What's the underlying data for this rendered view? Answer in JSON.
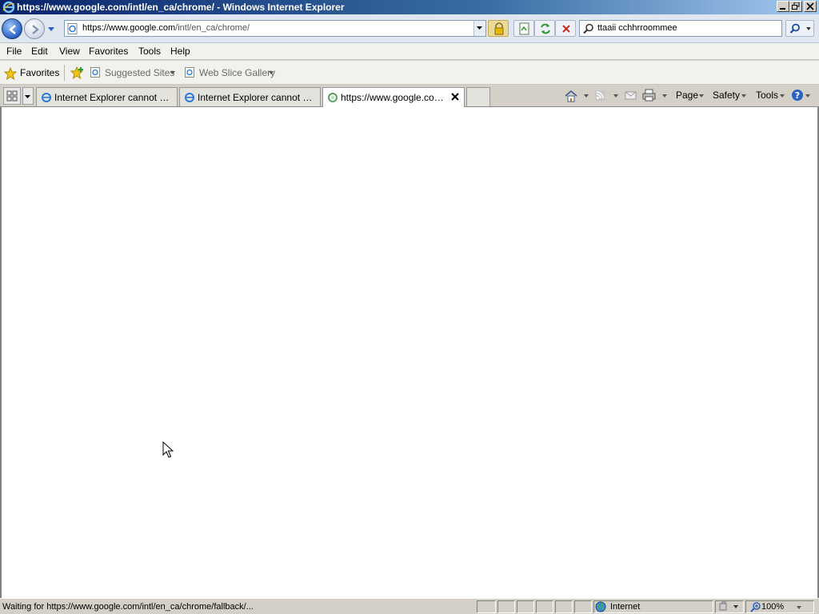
{
  "window": {
    "title": "https://www.google.com/intl/en_ca/chrome/ - Windows Internet Explorer"
  },
  "address_bar": {
    "url_host": "https://www.google.com",
    "url_path": "/intl/en_ca/chrome/"
  },
  "search": {
    "query": "ttaaii  cchhrroommee"
  },
  "menu": {
    "items": [
      "File",
      "Edit",
      "View",
      "Favorites",
      "Tools",
      "Help"
    ]
  },
  "favorites_bar": {
    "favorites_label": "Favorites",
    "links": [
      "Suggested Sites",
      "Web Slice Gallery"
    ]
  },
  "tabs": [
    {
      "label": "Internet Explorer cannot dis...",
      "active": false
    },
    {
      "label": "Internet Explorer cannot dis...",
      "active": false
    },
    {
      "label": "https://www.google.com...",
      "active": true
    }
  ],
  "command_bar": {
    "page_label": "Page",
    "safety_label": "Safety",
    "tools_label": "Tools"
  },
  "status_bar": {
    "text": "Waiting for https://www.google.com/intl/en_ca/chrome/fallback/...",
    "zone": "Internet",
    "zoom": "100%"
  },
  "colors": {
    "title_gradient_start": "#0a246a",
    "title_gradient_end": "#a6caf0",
    "chrome_bg": "#d4d0c8"
  },
  "icons": [
    "ie-icon",
    "back-icon",
    "forward-icon",
    "lock-icon",
    "compat-view-icon",
    "refresh-icon",
    "stop-icon",
    "search-icon",
    "star-icon",
    "home-icon",
    "rss-icon",
    "mail-icon",
    "print-icon",
    "help-icon",
    "globe-icon",
    "zoom-icon"
  ]
}
